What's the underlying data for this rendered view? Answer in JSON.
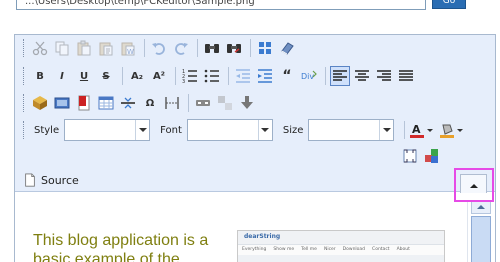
{
  "path_bar": {
    "value": "...\\Users\\Desktop\\temp\\FCKeditor\\Sample.png",
    "button_label": "Go"
  },
  "toolbar": {
    "row1": [
      "cut-icon",
      "copy-icon",
      "paste-icon",
      "paste-text-icon",
      "paste-word-icon",
      "undo-icon",
      "redo-icon",
      "find-icon",
      "replace-icon",
      "select-all-icon",
      "remove-format-icon"
    ],
    "row2": {
      "bold": "B",
      "italic": "I",
      "underline": "U",
      "strike": "S",
      "subscript": "A₂",
      "superscript": "A²",
      "blockquote": "“"
    },
    "combos": {
      "style_label": "Style",
      "font_label": "Font",
      "size_label": "Size"
    },
    "source_label": "Source"
  },
  "content": {
    "text": "This blog application is a basic example of the",
    "thumbnail_title": "dearString",
    "thumbnail_nav": [
      "Everything",
      "Show me",
      "Tell me",
      "Nicer",
      "Download",
      "Contact",
      "About"
    ]
  },
  "colors": {
    "toolbar_bg": "#e6eefb",
    "highlight": "#e64ae6",
    "content_text": "#7f7f10"
  }
}
